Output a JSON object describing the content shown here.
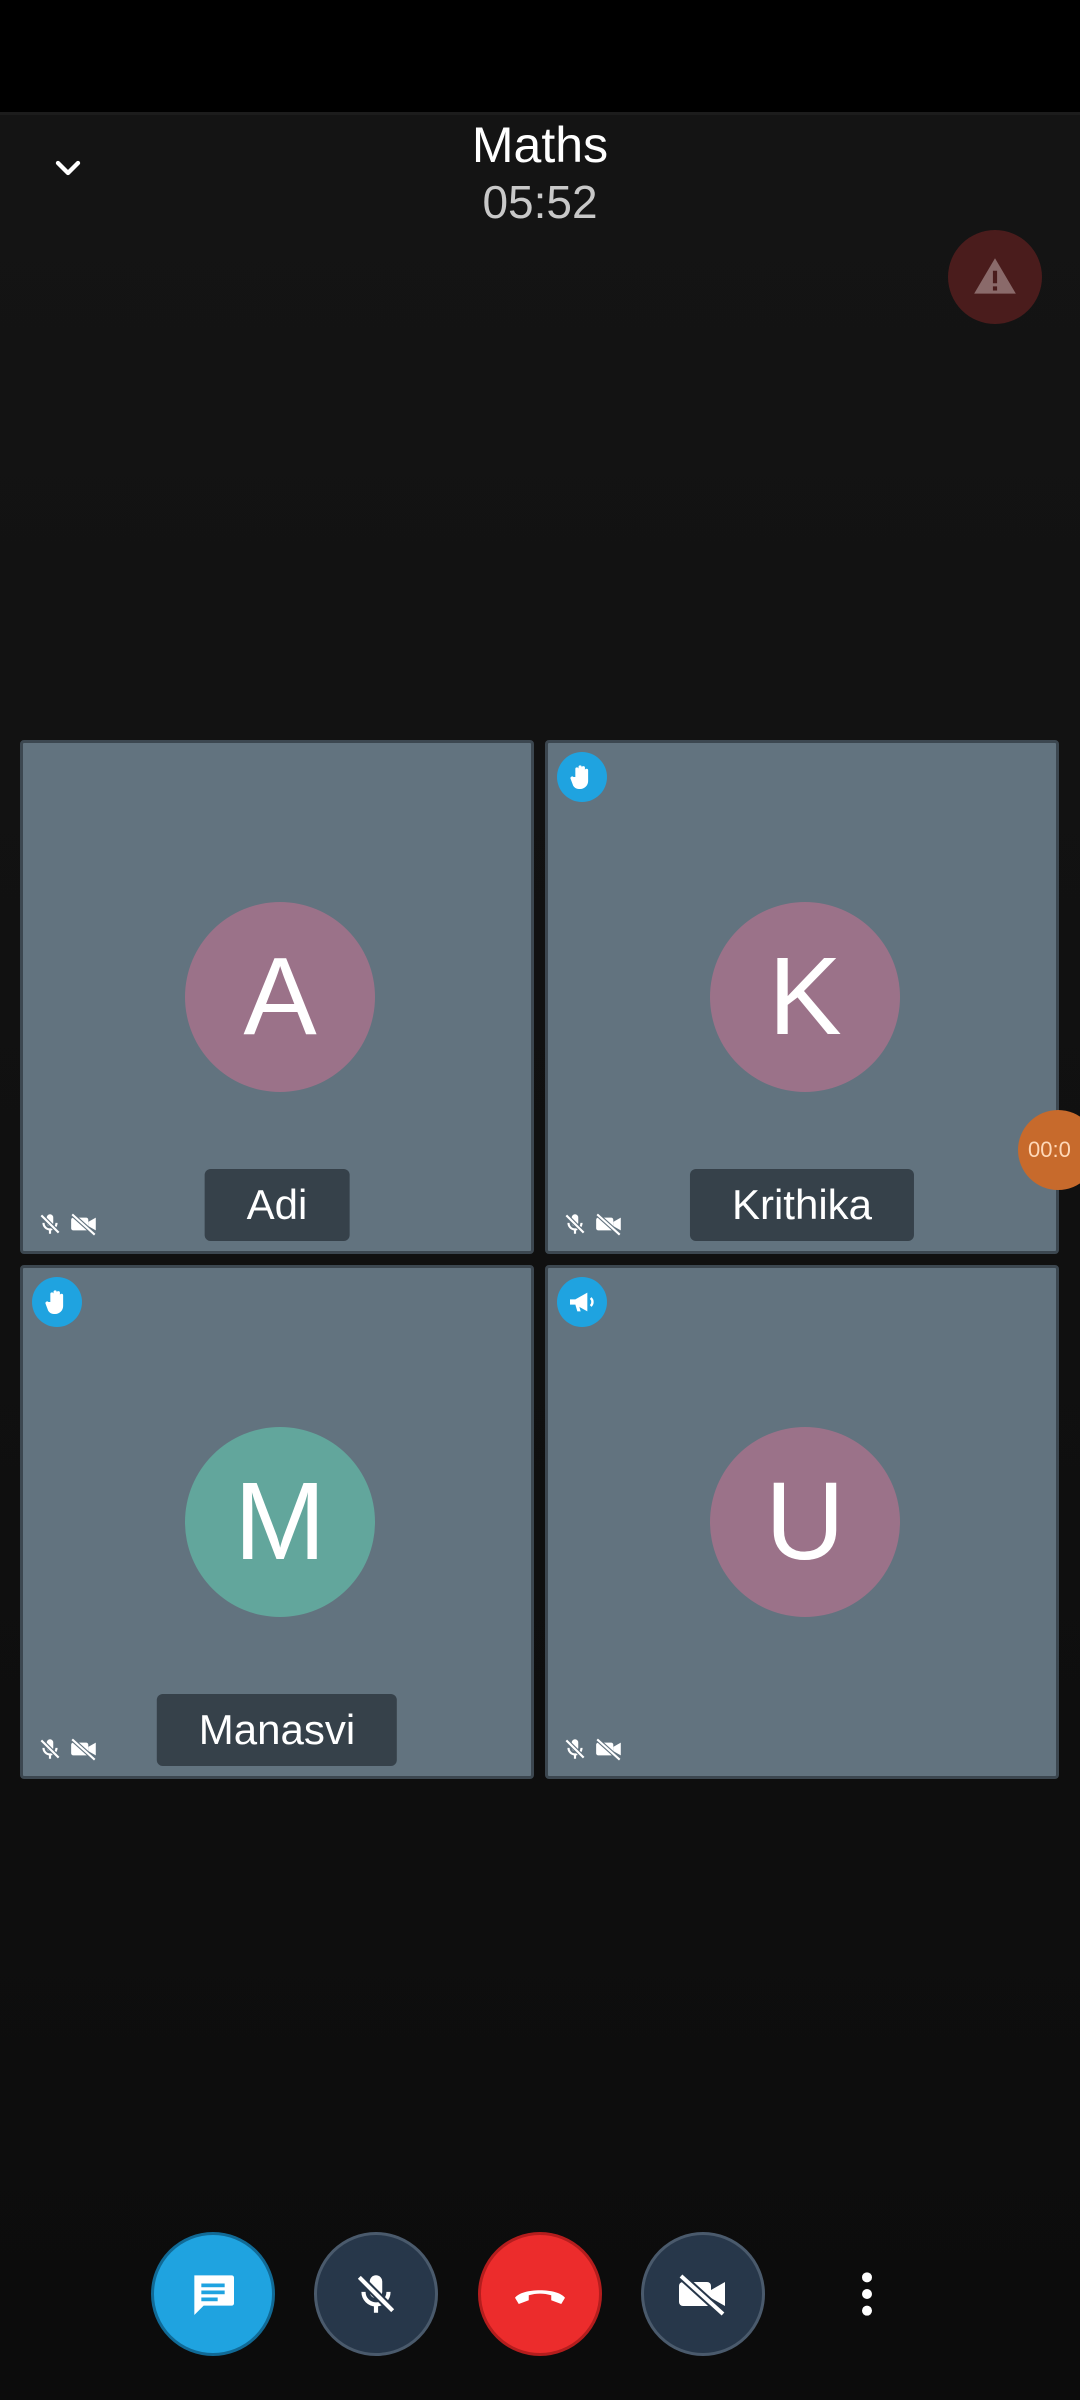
{
  "call": {
    "title": "Maths",
    "timer": "05:52"
  },
  "participants": [
    {
      "initial": "A",
      "name": "Adi",
      "avatar_color": "#9b7289",
      "badge": null,
      "mic": "muted",
      "camera": "off"
    },
    {
      "initial": "K",
      "name": "Krithika",
      "avatar_color": "#9b7289",
      "badge": "raised-hand",
      "mic": "muted",
      "camera": "off"
    },
    {
      "initial": "M",
      "name": "Manasvi",
      "avatar_color": "#62a69c",
      "badge": "raised-hand",
      "mic": "muted",
      "camera": "off"
    },
    {
      "initial": "U",
      "name": "",
      "avatar_color": "#9b7289",
      "badge": "megaphone",
      "mic": "muted",
      "camera": "off"
    }
  ],
  "side_timer": "00:0",
  "controls": {
    "chat": "chat-icon",
    "mic": "mic-off-icon",
    "end_call": "end-call-icon",
    "camera": "camera-off-icon",
    "more": "more-vertical-icon"
  },
  "colors": {
    "accent_blue": "#1fa3e0",
    "end_call_red": "#ec2c2c",
    "tile_bg": "#62737f"
  }
}
